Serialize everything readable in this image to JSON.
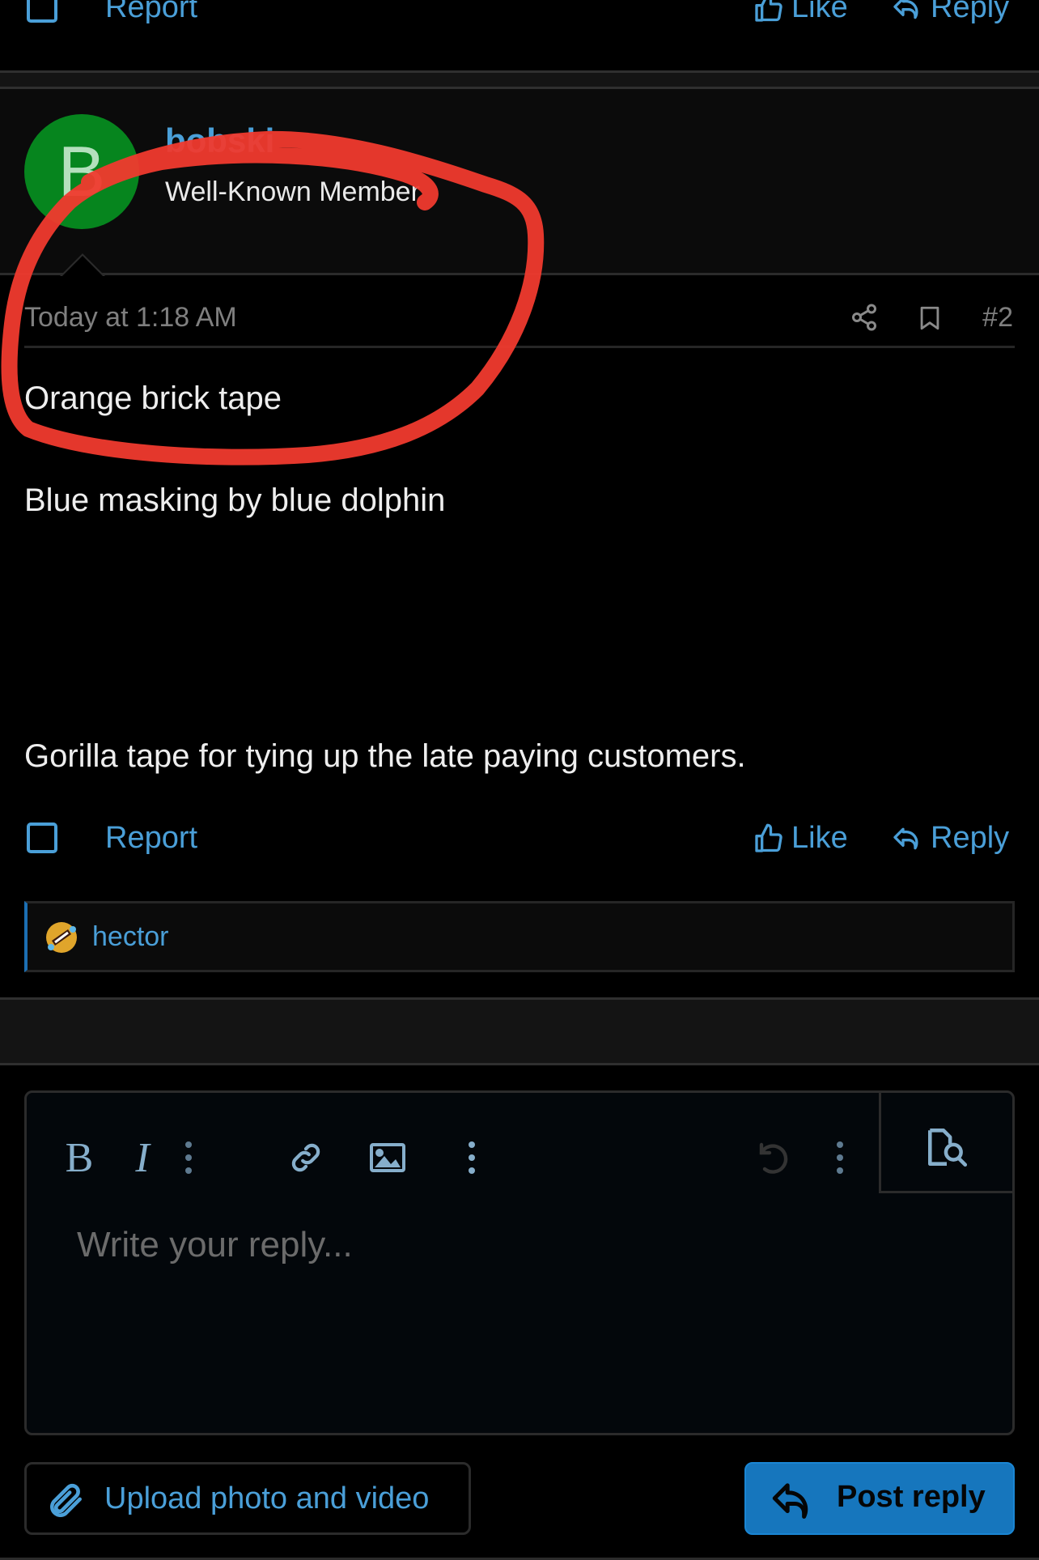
{
  "previous_post": {
    "report_label": "Report",
    "like_label": "Like",
    "reply_label": "Reply"
  },
  "post": {
    "avatar_letter": "B",
    "avatar_color": "#06851e",
    "username": "bobski",
    "user_title": "Well-Known Member",
    "timestamp": "Today at 1:18 AM",
    "post_number": "#2",
    "share_icon": "share-icon",
    "bookmark_icon": "bookmark-icon",
    "body": [
      "Orange brick tape",
      "Blue masking by blue dolphin",
      "Gorilla tape for tying up the late paying customers."
    ],
    "actions": {
      "report_label": "Report",
      "like_label": "Like",
      "reply_label": "Reply"
    },
    "reactions": {
      "emoji": "rolling-on-floor-laughing",
      "users": "hector"
    }
  },
  "editor": {
    "toolbar": {
      "bold": "B",
      "italic": "I",
      "more_text_icon": "more-vertical-icon",
      "link_icon": "link-icon",
      "image_icon": "image-icon",
      "more_insert_icon": "more-vertical-icon",
      "undo_icon": "undo-icon",
      "more_options_icon": "more-vertical-icon",
      "preview_icon": "preview-icon"
    },
    "placeholder": "Write your reply...",
    "value": ""
  },
  "buttons": {
    "upload_label": "Upload photo and video",
    "post_reply_label": "Post reply"
  },
  "colors": {
    "accent": "#4a9fd8",
    "primary_button": "#1676bd",
    "annotation": "#f03a2e"
  },
  "annotation": {
    "type": "red-freehand-circle",
    "encircles": "post-author-and-first-line"
  }
}
